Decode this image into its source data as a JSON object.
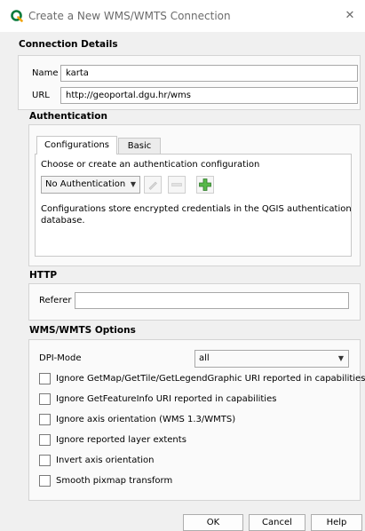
{
  "window": {
    "title": "Create a New WMS/WMTS Connection",
    "app_icon": "qgis-icon",
    "close_glyph": "✕",
    "accent_color": "#0b7b3c"
  },
  "connection": {
    "header": "Connection Details",
    "name_label": "Name",
    "name_value": "karta",
    "url_label": "URL",
    "url_value": "http://geoportal.dgu.hr/wms"
  },
  "auth": {
    "header": "Authentication",
    "tabs": [
      "Configurations",
      "Basic"
    ],
    "active_tab": "Configurations",
    "instruction": "Choose or create an authentication configuration",
    "combo_value": "No Authentication",
    "edit_icon": "pencil-icon",
    "remove_icon": "remove-icon",
    "add_icon": "add-icon",
    "note_line1": "Configurations store encrypted credentials in the QGIS authentication",
    "note_line2": "database."
  },
  "http": {
    "header": "HTTP",
    "referer_label": "Referer",
    "referer_value": ""
  },
  "options": {
    "header": "WMS/WMTS Options",
    "dpi_label": "DPI-Mode",
    "dpi_value": "all",
    "checkboxes": [
      {
        "label": "Ignore GetMap/GetTile/GetLegendGraphic URI reported in capabilities",
        "checked": false
      },
      {
        "label": "Ignore GetFeatureInfo URI reported in capabilities",
        "checked": false
      },
      {
        "label": "Ignore axis orientation (WMS 1.3/WMTS)",
        "checked": false
      },
      {
        "label": "Ignore reported layer extents",
        "checked": false
      },
      {
        "label": "Invert axis orientation",
        "checked": false
      },
      {
        "label": "Smooth pixmap transform",
        "checked": false
      }
    ]
  },
  "buttons": {
    "ok": "OK",
    "cancel": "Cancel",
    "help": "Help"
  }
}
